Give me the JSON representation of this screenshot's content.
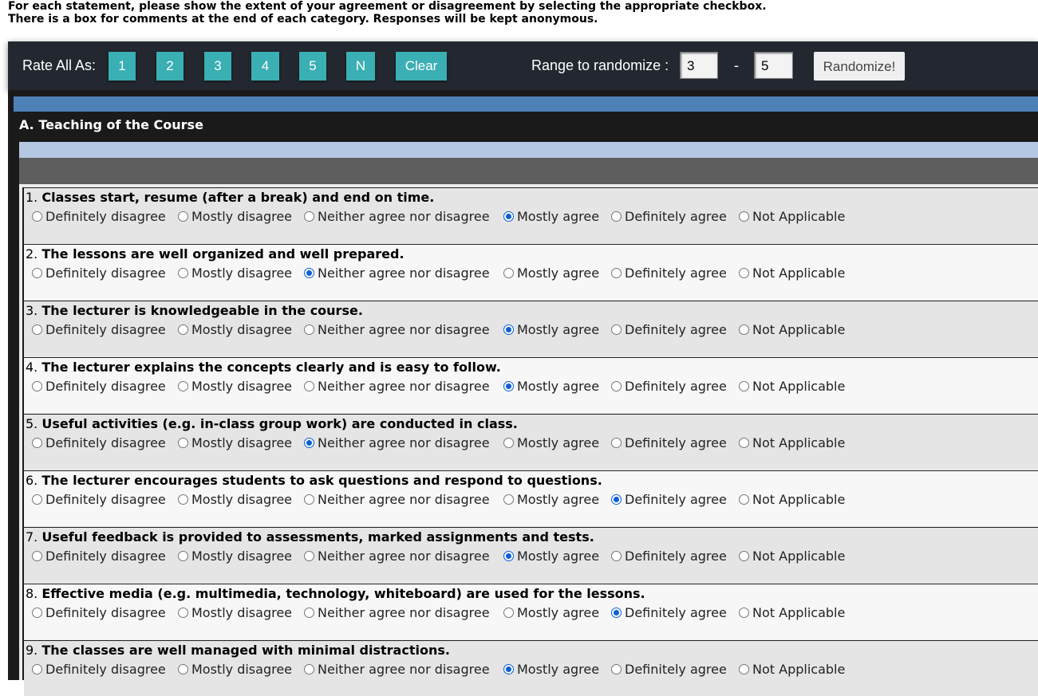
{
  "intro": {
    "line1": "For each statement, please show the extent of your agreement or disagreement by selecting the appropriate checkbox.",
    "line2": "There is a box for comments at the end of each category. Responses will be kept anonymous."
  },
  "toolbar": {
    "rate_all_label": "Rate All As:",
    "buttons": [
      "1",
      "2",
      "3",
      "4",
      "5",
      "N",
      "Clear"
    ],
    "range_label": "Range to randomize :",
    "range_from": "3",
    "range_sep": "-",
    "range_to": "5",
    "randomize_label": "Randomize!",
    "button_color": "#3aafb4"
  },
  "section": {
    "title": "A. Teaching of the Course"
  },
  "options": [
    "Definitely disagree",
    "Mostly disagree",
    "Neither agree nor disagree",
    "Mostly agree",
    "Definitely agree",
    "Not Applicable"
  ],
  "questions": [
    {
      "num": "1.",
      "text": "Classes start, resume (after a break) and end on time.",
      "selected": "Mostly agree"
    },
    {
      "num": "2.",
      "text": "The lessons are well organized and well prepared.",
      "selected": "Neither agree nor disagree"
    },
    {
      "num": "3.",
      "text": "The lecturer is knowledgeable in the course.",
      "selected": "Mostly agree"
    },
    {
      "num": "4.",
      "text": "The lecturer explains the concepts clearly and is easy to follow.",
      "selected": "Mostly agree"
    },
    {
      "num": "5.",
      "text": "Useful activities (e.g. in-class group work) are conducted in class.",
      "selected": "Neither agree nor disagree"
    },
    {
      "num": "6.",
      "text": "The lecturer encourages students to ask questions and respond to questions.",
      "selected": "Definitely agree"
    },
    {
      "num": "7.",
      "text": "Useful feedback is provided to assessments, marked assignments and tests.",
      "selected": "Mostly agree"
    },
    {
      "num": "8.",
      "text": "Effective media (e.g. multimedia, technology, whiteboard) are used for the lessons.",
      "selected": "Definitely agree"
    },
    {
      "num": "9.",
      "text": "The classes are well managed with minimal distractions.",
      "selected": "Mostly agree"
    }
  ]
}
